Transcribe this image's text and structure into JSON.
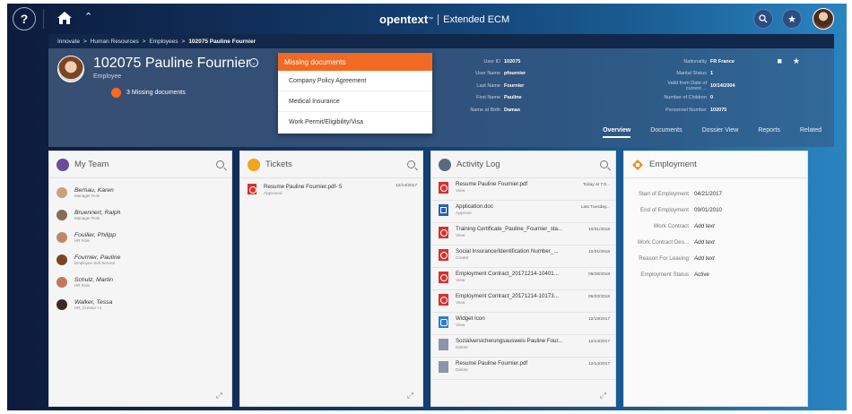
{
  "topbar": {
    "help_label": "?",
    "brand_logo": "opentext",
    "brand_tm": "™",
    "brand_product": "Extended ECM",
    "icons": [
      "help-icon",
      "home-icon",
      "caret-up-icon",
      "search-icon",
      "star-icon",
      "user-avatar"
    ]
  },
  "breadcrumb": {
    "items": [
      "Innovate",
      "Human Resources",
      "Employees",
      "102075 Pauline Fournier"
    ],
    "separator": ">"
  },
  "header": {
    "name": "102075 Pauline Fournier",
    "role": "Employee",
    "missing_text": "3 Missing documents",
    "info_left": [
      {
        "label": "User ID",
        "value": "102075"
      },
      {
        "label": "User Name",
        "value": "pfournier"
      },
      {
        "label": "Last Name",
        "value": "Fournier"
      },
      {
        "label": "First Name",
        "value": "Pauline"
      },
      {
        "label": "Name at Birth",
        "value": "Damas"
      }
    ],
    "info_right": [
      {
        "label": "Nationality",
        "value": "FR France"
      },
      {
        "label": "Marital Status",
        "value": "1"
      },
      {
        "label": "Valid from Date of current ...",
        "value": "10/14/2004"
      },
      {
        "label": "Number of Children",
        "value": "0"
      },
      {
        "label": "Personnel Number",
        "value": "102075"
      }
    ],
    "tabs": [
      {
        "label": "Overview",
        "active": true
      },
      {
        "label": "Documents",
        "active": false
      },
      {
        "label": "Dossier View",
        "active": false
      },
      {
        "label": "Reports",
        "active": false
      },
      {
        "label": "Related",
        "active": false
      }
    ]
  },
  "dropdown": {
    "header": "Missing documents",
    "items": [
      "Company Policy Agreement",
      "Medical Insurance",
      "Work Permit/Eligibility/Visa"
    ]
  },
  "team": {
    "title": "My Team",
    "members": [
      {
        "name": "Bernau, Karen",
        "role": "Manager Role"
      },
      {
        "name": "Bruennert, Ralph",
        "role": "Manager Role"
      },
      {
        "name": "Fouilier, Philipp",
        "role": "HR Role"
      },
      {
        "name": "Fournier, Pauline",
        "role": "Employee Self Service"
      },
      {
        "name": "Schulz, Martin",
        "role": "HR Role"
      },
      {
        "name": "Walker, Tessa",
        "role": "HR_Creator +1"
      }
    ]
  },
  "tickets": {
    "title": "Tickets",
    "items": [
      {
        "name": "Resume Pauline Fournier.pdf- 5",
        "status": "Approved",
        "date": "12/14/2017"
      }
    ]
  },
  "activity": {
    "title": "Activity Log",
    "items": [
      {
        "name": "Resume Pauline Fournier.pdf",
        "action": "View",
        "date": "Today at 7:0...",
        "icon": "pdf"
      },
      {
        "name": "Application.doc",
        "action": "Approve",
        "date": "Last Tuesday...",
        "icon": "word"
      },
      {
        "name": "Training Certificate_Pauline_Fournier_sta...",
        "action": "View",
        "date": "10/31/2018",
        "icon": "pdf"
      },
      {
        "name": "Social Insurance/Identification Number_...",
        "action": "Create",
        "date": "10/31/2018",
        "icon": "pdf"
      },
      {
        "name": "Employment Contract_20171214-10401...",
        "action": "View",
        "date": "09/28/2018",
        "icon": "pdf"
      },
      {
        "name": "Employment Contract_20171214-10173...",
        "action": "View",
        "date": "09/20/2018",
        "icon": "pdf"
      },
      {
        "name": "Widget Icon",
        "action": "View",
        "date": "12/19/2017",
        "icon": "widget"
      },
      {
        "name": "Sozialversicherungsausweis Pauline Four...",
        "action": "Delete",
        "date": "12/14/2017",
        "icon": "generic"
      },
      {
        "name": "Resume Pauline Fournier.pdf",
        "action": "Delete",
        "date": "12/14/2017",
        "icon": "generic"
      }
    ]
  },
  "employment": {
    "title": "Employment",
    "rows": [
      {
        "label": "Start of Employment",
        "value": "04/21/2017",
        "italic": false
      },
      {
        "label": "End of Employment",
        "value": "09/01/2010",
        "italic": false
      },
      {
        "label": "Work Contract",
        "value": "Add text",
        "italic": true
      },
      {
        "label": "Work Contract Des...",
        "value": "Add text",
        "italic": true
      },
      {
        "label": "Reason For Leaving",
        "value": "Add text",
        "italic": true
      },
      {
        "label": "Employment Status",
        "value": "Active",
        "italic": false
      }
    ]
  },
  "colors": {
    "accent_orange": "#f06a24",
    "pdf_red": "#d9302b",
    "word_blue": "#2b5eb0"
  }
}
